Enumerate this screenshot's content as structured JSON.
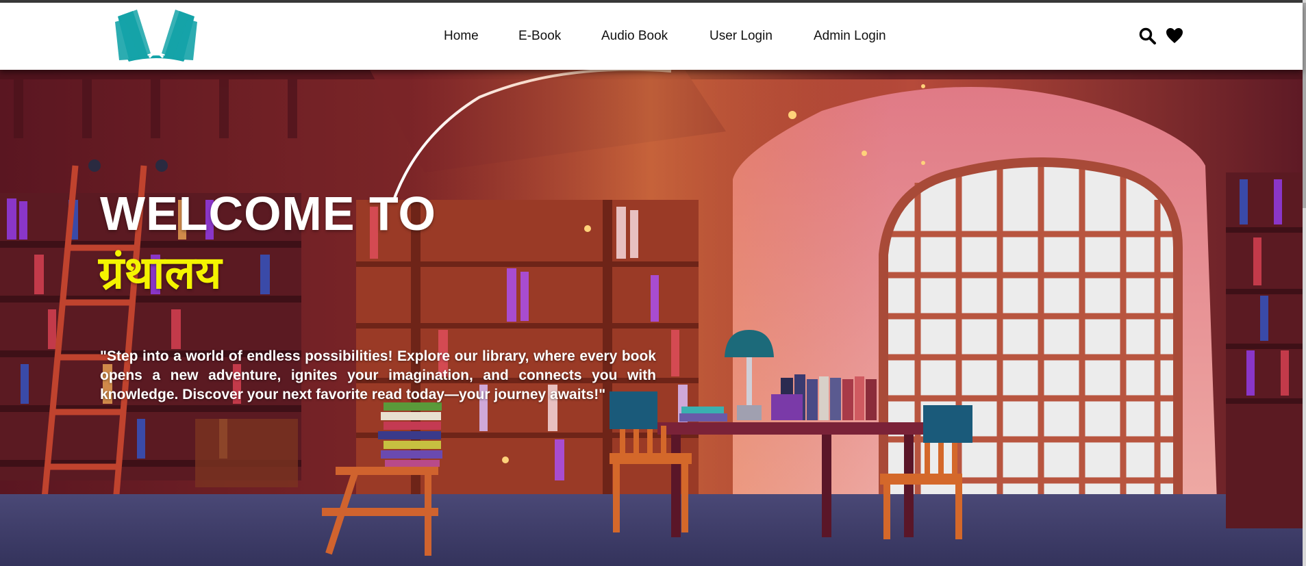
{
  "nav": {
    "logo_icon": "open-book-logo",
    "links": [
      "Home",
      "E-Book",
      "Audio Book",
      "User Login",
      "Admin Login"
    ],
    "icons": [
      "search-icon",
      "heart-icon"
    ]
  },
  "hero": {
    "welcome": "WELCOME TO",
    "brand": "ग्रंथालय",
    "tagline": "\"Step into a world of endless possibilities! Explore our library, where every book opens a new adventure, ignites your imagination, and connects you with knowledge. Discover your next favorite read today—your journey awaits!\""
  },
  "colors": {
    "logo_teal": "#15a3a8",
    "brand_yellow": "#f4f400",
    "hero_wall": "#6b1e2a",
    "hero_floor": "#3f3f6e"
  }
}
